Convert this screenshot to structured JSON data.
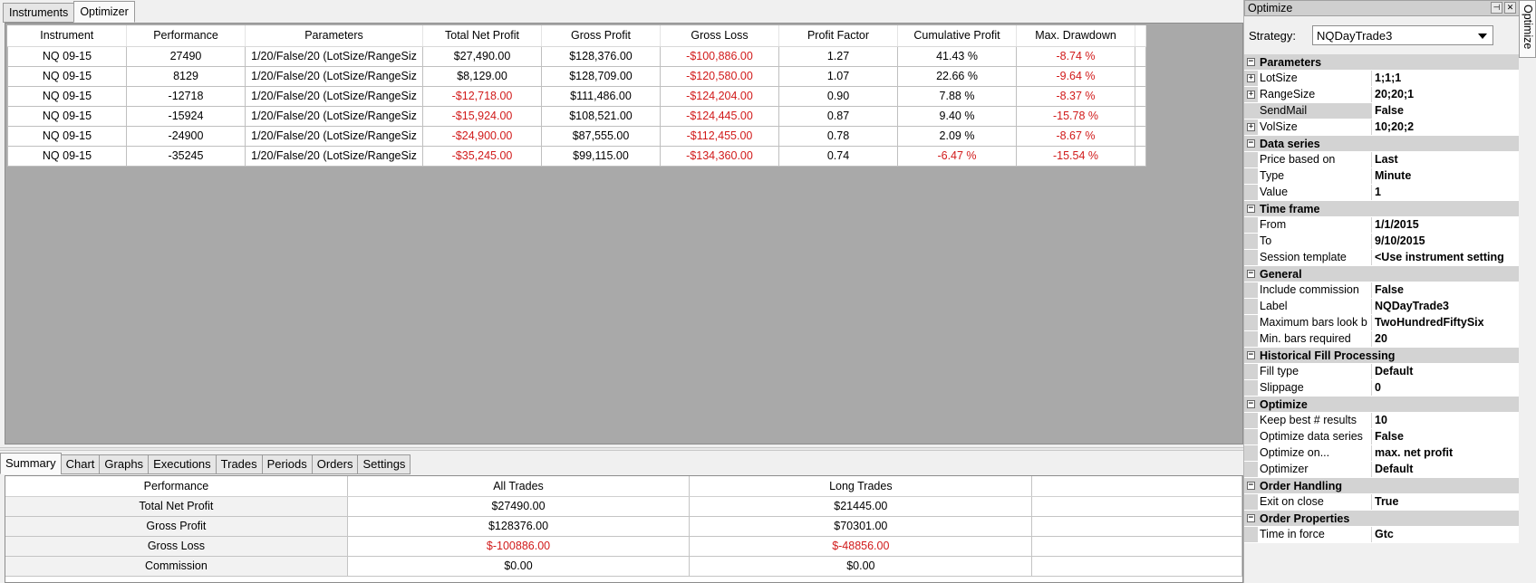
{
  "top_tabs": [
    "Instruments",
    "Optimizer"
  ],
  "results": {
    "columns": [
      "Instrument",
      "Performance",
      "Parameters",
      "Total Net Profit",
      "Gross Profit",
      "Gross Loss",
      "Profit Factor",
      "Cumulative Profit",
      "Max. Drawdown"
    ],
    "rows": [
      [
        "NQ 09-15",
        "27490",
        "1/20/False/20 (LotSize/RangeSiz",
        "$27,490.00",
        "$128,376.00",
        "-$100,886.00",
        "1.27",
        "41.43 %",
        "-8.74 %"
      ],
      [
        "NQ 09-15",
        "8129",
        "1/20/False/20 (LotSize/RangeSiz",
        "$8,129.00",
        "$128,709.00",
        "-$120,580.00",
        "1.07",
        "22.66 %",
        "-9.64 %"
      ],
      [
        "NQ 09-15",
        "-12718",
        "1/20/False/20 (LotSize/RangeSiz",
        "-$12,718.00",
        "$111,486.00",
        "-$124,204.00",
        "0.90",
        "7.88 %",
        "-8.37 %"
      ],
      [
        "NQ 09-15",
        "-15924",
        "1/20/False/20 (LotSize/RangeSiz",
        "-$15,924.00",
        "$108,521.00",
        "-$124,445.00",
        "0.87",
        "9.40 %",
        "-15.78 %"
      ],
      [
        "NQ 09-15",
        "-24900",
        "1/20/False/20 (LotSize/RangeSiz",
        "-$24,900.00",
        "$87,555.00",
        "-$112,455.00",
        "0.78",
        "2.09 %",
        "-8.67 %"
      ],
      [
        "NQ 09-15",
        "-35245",
        "1/20/False/20 (LotSize/RangeSiz",
        "-$35,245.00",
        "$99,115.00",
        "-$134,360.00",
        "0.74",
        "-6.47 %",
        "-15.54 %"
      ]
    ]
  },
  "bottom_tabs": [
    "Summary",
    "Chart",
    "Graphs",
    "Executions",
    "Trades",
    "Periods",
    "Orders",
    "Settings"
  ],
  "summary": {
    "columns": [
      "Performance",
      "All Trades",
      "Long Trades"
    ],
    "rows": [
      [
        "Total Net Profit",
        "$27490.00",
        "$21445.00"
      ],
      [
        "Gross Profit",
        "$128376.00",
        "$70301.00"
      ],
      [
        "Gross Loss",
        "$-100886.00",
        "$-48856.00"
      ],
      [
        "Commission",
        "$0.00",
        "$0.00"
      ]
    ]
  },
  "panel": {
    "title": "Optimize",
    "side_tab": "Optimize",
    "strategy_label": "Strategy:",
    "strategy_value": "NQDayTrade3",
    "sections": [
      {
        "title": "Parameters",
        "props": [
          {
            "name": "LotSize",
            "value": "1;1;1",
            "expandable": true
          },
          {
            "name": "RangeSize",
            "value": "20;20;1",
            "expandable": true
          },
          {
            "name": "SendMail",
            "value": "False",
            "selected": true
          },
          {
            "name": "VolSize",
            "value": "10;20;2",
            "expandable": true
          }
        ]
      },
      {
        "title": "Data series",
        "props": [
          {
            "name": "Price based on",
            "value": "Last"
          },
          {
            "name": "Type",
            "value": "Minute"
          },
          {
            "name": "Value",
            "value": "1"
          }
        ]
      },
      {
        "title": "Time frame",
        "props": [
          {
            "name": "From",
            "value": "1/1/2015"
          },
          {
            "name": "To",
            "value": "9/10/2015"
          },
          {
            "name": "Session template",
            "value": "<Use instrument setting"
          }
        ]
      },
      {
        "title": "General",
        "props": [
          {
            "name": "Include commission",
            "value": "False"
          },
          {
            "name": "Label",
            "value": "NQDayTrade3"
          },
          {
            "name": "Maximum bars look b",
            "value": "TwoHundredFiftySix"
          },
          {
            "name": "Min. bars required",
            "value": "20"
          }
        ]
      },
      {
        "title": "Historical Fill Processing",
        "props": [
          {
            "name": "Fill type",
            "value": "Default"
          },
          {
            "name": "Slippage",
            "value": "0"
          }
        ]
      },
      {
        "title": "Optimize",
        "props": [
          {
            "name": "Keep best # results",
            "value": "10"
          },
          {
            "name": "Optimize data series",
            "value": "False"
          },
          {
            "name": "Optimize on...",
            "value": "max. net profit"
          },
          {
            "name": "Optimizer",
            "value": "Default"
          }
        ]
      },
      {
        "title": "Order Handling",
        "props": [
          {
            "name": "Exit on close",
            "value": "True"
          }
        ]
      },
      {
        "title": "Order Properties",
        "props": [
          {
            "name": "Time in force",
            "value": "Gtc"
          }
        ]
      }
    ]
  },
  "colors": {
    "negative": "#d11a1a",
    "category_bg": "#d3d3d3",
    "grid_empty": "#a9a9a9"
  }
}
